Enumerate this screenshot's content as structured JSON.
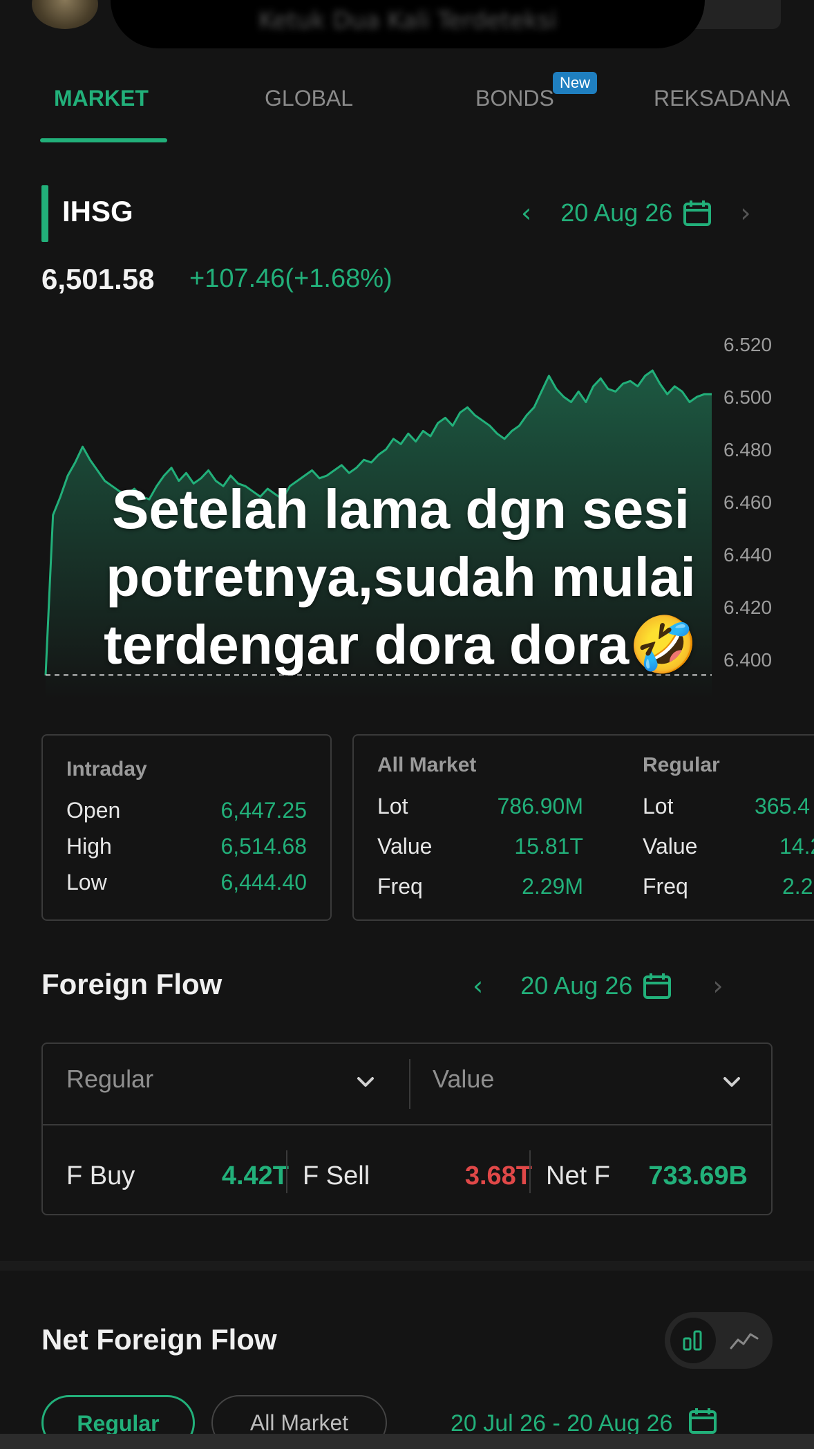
{
  "top": {
    "notification_text": "Ketuk Dua Kali Terdeteksi"
  },
  "tabs": [
    {
      "label": "MARKET",
      "active": true
    },
    {
      "label": "GLOBAL",
      "active": false
    },
    {
      "label": "BONDS",
      "active": false,
      "badge": "New"
    },
    {
      "label": "REKSADANA",
      "active": false
    }
  ],
  "index": {
    "name": "IHSG",
    "date": "20 Aug 26",
    "price": "6,501.58",
    "change": "+107.46(+1.68%)"
  },
  "chart_data": {
    "type": "area",
    "title": "",
    "xlabel": "",
    "ylabel": "",
    "ylim": [
      6400,
      6520
    ],
    "y_ticks": [
      "6.520",
      "6.500",
      "6.480",
      "6.460",
      "6.440",
      "6.420",
      "6.400"
    ],
    "y_tick_values": [
      6520,
      6500,
      6480,
      6460,
      6440,
      6420,
      6400
    ],
    "baseline": 6394.12,
    "series": [
      {
        "values": [
          6394,
          6455,
          6462,
          6470,
          6475,
          6481,
          6476,
          6472,
          6468,
          6466,
          6464,
          6463,
          6465,
          6462,
          6461,
          6466,
          6470,
          6473,
          6468,
          6471,
          6467,
          6469,
          6472,
          6468,
          6466,
          6470,
          6467,
          6466,
          6464,
          6462,
          6465,
          6463,
          6461,
          6466,
          6468,
          6470,
          6472,
          6469,
          6470,
          6472,
          6474,
          6471,
          6473,
          6476,
          6475,
          6478,
          6480,
          6484,
          6482,
          6486,
          6483,
          6487,
          6485,
          6490,
          6492,
          6489,
          6494,
          6496,
          6493,
          6491,
          6489,
          6486,
          6484,
          6487,
          6489,
          6493,
          6496,
          6502,
          6508,
          6503,
          6500,
          6498,
          6502,
          6498,
          6504,
          6507,
          6503,
          6502,
          6505,
          6506,
          6504,
          6508,
          6510,
          6505,
          6501,
          6504,
          6502,
          6498,
          6500,
          6501,
          6501
        ]
      }
    ]
  },
  "caption": "Setelah lama dgn sesi potretnya,sudah mulai terdengar dora dora🤣",
  "intraday": {
    "title": "Intraday",
    "rows": [
      {
        "label": "Open",
        "value": "6,447.25"
      },
      {
        "label": "High",
        "value": "6,514.68"
      },
      {
        "label": "Low",
        "value": "6,444.40"
      }
    ]
  },
  "all_market": {
    "title": "All Market",
    "rows": [
      {
        "label": "Lot",
        "value": "786.90M"
      },
      {
        "label": "Value",
        "value": "15.81T"
      },
      {
        "label": "Freq",
        "value": "2.29M"
      }
    ]
  },
  "regular": {
    "title": "Regular",
    "rows": [
      {
        "label": "Lot",
        "value": "365.4"
      },
      {
        "label": "Value",
        "value": "14.2"
      },
      {
        "label": "Freq",
        "value": "2.2"
      }
    ]
  },
  "foreign_flow": {
    "title": "Foreign Flow",
    "date": "20 Aug 26",
    "market_select": "Regular",
    "metric_select": "Value",
    "buy_label": "F Buy",
    "buy_value": "4.42T",
    "sell_label": "F Sell",
    "sell_value": "3.68T",
    "net_label": "Net F",
    "net_value": "733.69B"
  },
  "net_foreign_flow": {
    "title": "Net Foreign Flow",
    "pills": [
      "Regular",
      "All Market"
    ],
    "range": "20 Jul 26 - 20 Aug 26"
  },
  "colors": {
    "accent": "#22b07a",
    "negative": "#e04848",
    "background": "#141414"
  }
}
